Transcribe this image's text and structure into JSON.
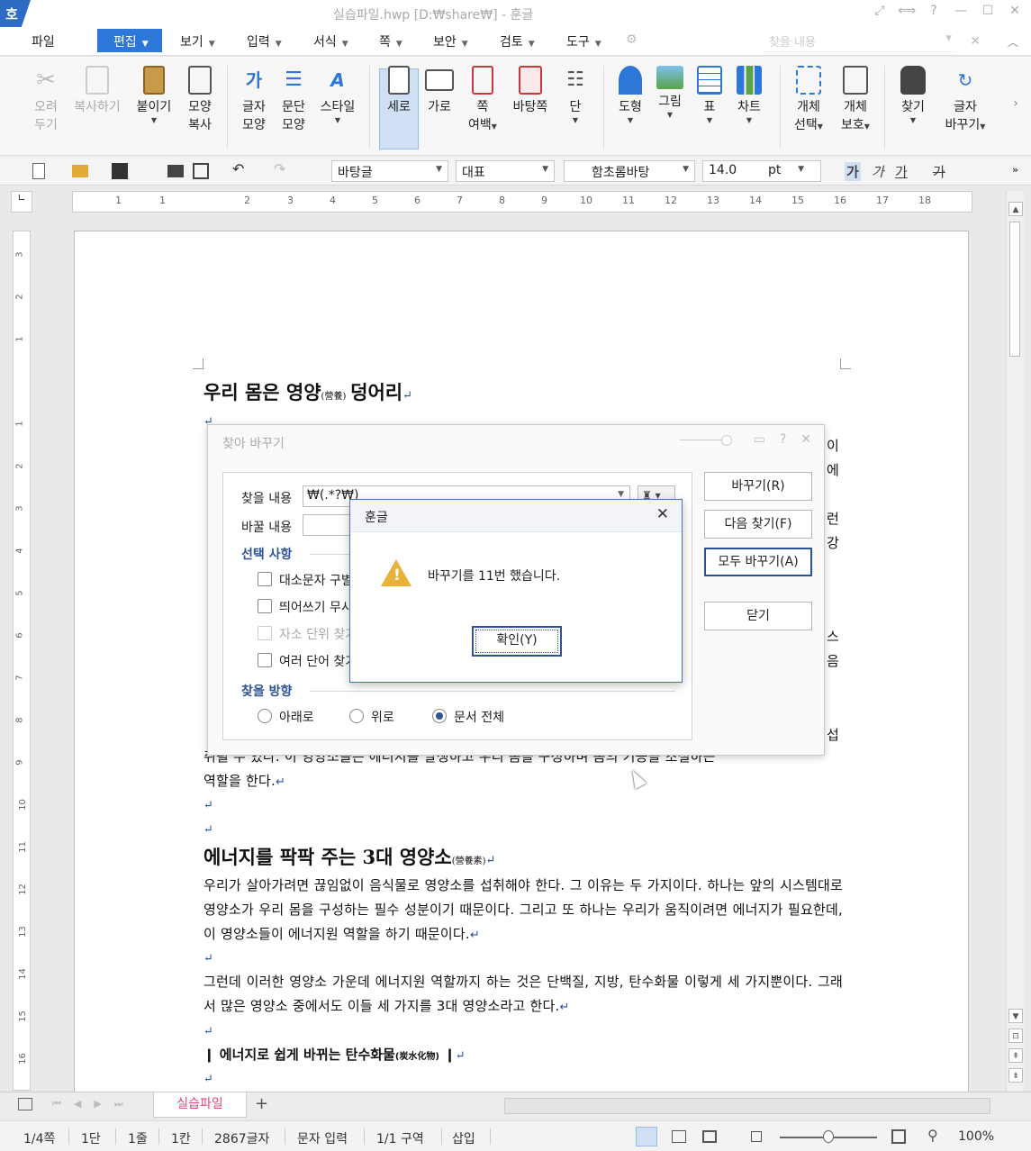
{
  "titlebar": {
    "logo": "호",
    "title": "실습파일.hwp [D:₩share₩] - 훈글"
  },
  "menu": {
    "file": "파일",
    "active": "편집",
    "items": [
      "보기",
      "입력",
      "서식",
      "쪽",
      "보안",
      "검토",
      "도구"
    ],
    "search_placeholder": "찾을 내용"
  },
  "ribbon": {
    "cut": [
      "오려",
      "두기"
    ],
    "copy": "복사하기",
    "paste": "붙이기",
    "format_copy": [
      "모양",
      "복사"
    ],
    "char_shape": [
      "글자",
      "모양"
    ],
    "para_shape": [
      "문단",
      "모양"
    ],
    "style": "스타일",
    "portrait": "세로",
    "landscape": "가로",
    "margins": [
      "쪽",
      "여백"
    ],
    "page_bg": "바탕쪽",
    "columns": "단",
    "shape": "도형",
    "picture": "그림",
    "table": "표",
    "chart": "차트",
    "obj_select": [
      "개체",
      "선택"
    ],
    "obj_protect": [
      "개체",
      "보호"
    ],
    "find": "찾기",
    "replace": [
      "글자",
      "바꾸기"
    ]
  },
  "format": {
    "style": "바탕글",
    "lang": "대표",
    "font": "함초롬바탕",
    "size": "14.0",
    "unit": "pt",
    "bold": "가",
    "italic": "가",
    "underline": "가",
    "strike": "가"
  },
  "ruler": {
    "h_ticks": [
      "1",
      "1",
      "2",
      "3",
      "4",
      "5",
      "6",
      "7",
      "8",
      "9",
      "10",
      "11",
      "12",
      "13",
      "14",
      "15",
      "16",
      "17",
      "18"
    ],
    "v_ticks": [
      "3",
      "2",
      "1",
      "1",
      "2",
      "3",
      "4",
      "5",
      "6",
      "7",
      "8",
      "9",
      "10",
      "11",
      "12",
      "13",
      "14",
      "15",
      "16"
    ]
  },
  "document": {
    "heading1": "우리 몸은 영양",
    "heading1_hanja": "(營養)",
    "heading1_tail": "덩어리",
    "frag_right": [
      "이",
      "에",
      "런",
      "강",
      "스",
      "음",
      "섭"
    ],
    "para_partial": "취될 수 있다. 이 영양소들은 에너지를 발생하고 우리 몸을 구성하며 몸의 기능을 조절하는",
    "para_partial2": "역할을 한다.",
    "heading2": "에너지를 팍팍 주는 3대 영양소",
    "heading2_hanja": "(營養素)",
    "para1": "  우리가 살아가려면 끊임없이 음식물로 영양소를 섭취해야 한다. 그 이유는 두 가지이다. 하나는 앞의 시스템대로 영양소가 우리 몸을 구성하는 필수 성분이기 때문이다. 그리고 또 하나는 우리가 움직이려면 에너지가 필요한데, 이 영양소들이 에너지원 역할을 하기 때문이다.",
    "para2": "그런데 이러한 영양소 가운데 에너지원 역할까지 하는 것은 단백질, 지방, 탄수화물 이렇게 세 가지뿐이다. 그래서 많은 영양소 중에서도 이들 세 가지를 3대 영양소라고 한다.",
    "bullet": "❙ 에너지로 쉽게 바뀌는 탄수화물",
    "bullet_hanja": "(炭水化物)",
    "para_mark": "↵"
  },
  "find_dialog": {
    "title": "찾아 바꾸기",
    "find_label": "찾을 내용",
    "find_value": "₩(.*?₩)",
    "replace_label": "바꿀 내용",
    "replace_value": "",
    "options_group": "선택 사항",
    "opt1": "대소문자 구별",
    "opt2": "띄어쓰기 무시",
    "opt3": "자소 단위 찾기",
    "opt4": "여러 단어 찾기",
    "direction_group": "찾을 방향",
    "dir_down": "아래로",
    "dir_up": "위로",
    "dir_all": "문서 전체",
    "btn_replace": "바꾸기(R)",
    "btn_next": "다음 찾기(F)",
    "btn_replace_all": "모두 바꾸기(A)",
    "btn_close": "닫기"
  },
  "msgbox": {
    "title": "훈글",
    "text": "바꾸기를 11번 했습니다.",
    "ok": "확인(Y)"
  },
  "tabs": {
    "active": "실습파일",
    "add": "+"
  },
  "status": {
    "page": "1/4쪽",
    "col": "1단",
    "line": "1줄",
    "char": "1칸",
    "count": "2867글자",
    "mode": "문자 입력",
    "section": "1/1 구역",
    "insert": "삽입",
    "zoom": "100%"
  },
  "colors": {
    "accent": "#2d77d8",
    "tab_active": "#e0457b",
    "warning": "#e8b23a"
  }
}
